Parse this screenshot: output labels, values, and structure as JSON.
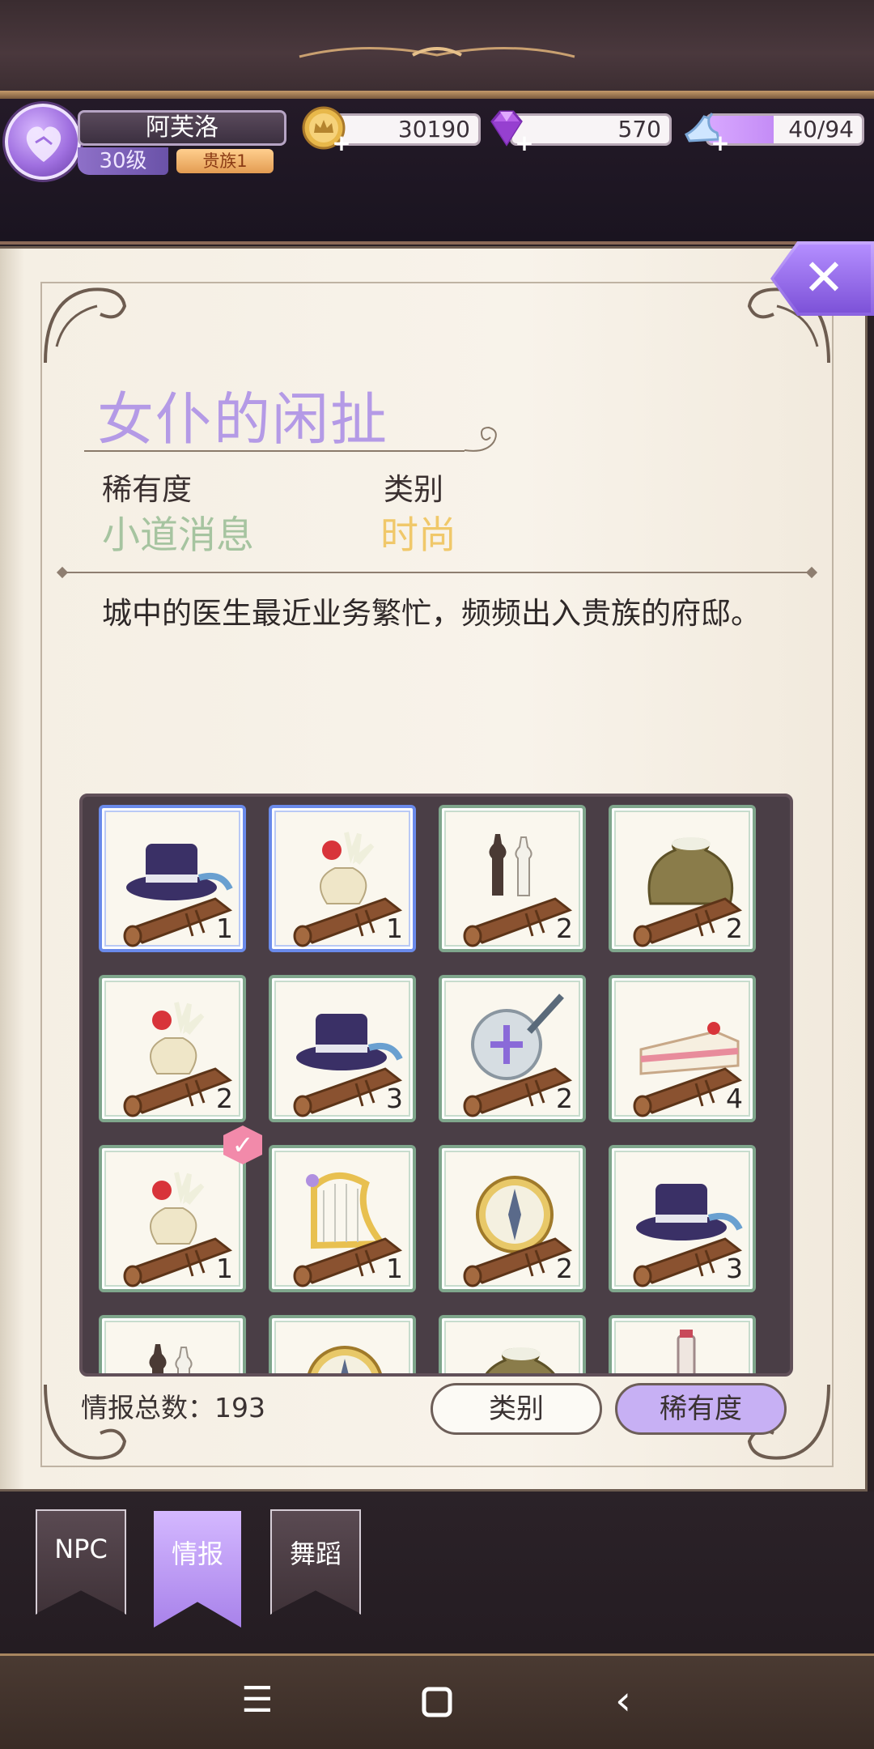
{
  "player": {
    "name": "阿芙洛",
    "level": "30级",
    "noble_rank": "贵族1"
  },
  "resources": {
    "gold": "30190",
    "diamonds": "570",
    "stamina": "40/94",
    "stamina_fraction": 0.4255
  },
  "detail": {
    "title": "女仆的闲扯",
    "rarity_label": "稀有度",
    "rarity_value": "小道消息",
    "type_label": "类别",
    "type_value": "时尚",
    "description": "城中的医生最近业务繁忙，频频出入贵族的府邸。"
  },
  "grid": {
    "items": [
      {
        "icon": "top-hat-scroll-icon",
        "count": "1",
        "selected": true
      },
      {
        "icon": "flower-vase-scroll-icon",
        "count": "1",
        "selected": true
      },
      {
        "icon": "chess-scroll-icon",
        "count": "2",
        "selected": false
      },
      {
        "icon": "sack-scroll-icon",
        "count": "2",
        "selected": false
      },
      {
        "icon": "flower-vase-scroll-icon",
        "count": "2",
        "selected": false
      },
      {
        "icon": "top-hat-scroll-icon",
        "count": "3",
        "selected": false
      },
      {
        "icon": "sword-shield-scroll-icon",
        "count": "2",
        "selected": false
      },
      {
        "icon": "cake-scroll-icon",
        "count": "4",
        "selected": false
      },
      {
        "icon": "flower-vase-scroll-icon",
        "count": "1",
        "selected": false
      },
      {
        "icon": "harp-scroll-icon",
        "count": "1",
        "selected": false
      },
      {
        "icon": "compass-scroll-icon",
        "count": "2",
        "selected": false
      },
      {
        "icon": "top-hat-scroll-icon",
        "count": "3",
        "selected": false
      },
      {
        "icon": "chess-scroll-icon",
        "count": "",
        "selected": false
      },
      {
        "icon": "compass-scroll-icon",
        "count": "",
        "selected": false
      },
      {
        "icon": "sack-scroll-icon",
        "count": "",
        "selected": false
      },
      {
        "icon": "bottle-scroll-icon",
        "count": "",
        "selected": false
      }
    ]
  },
  "footer": {
    "total_label": "情报总数：193",
    "sort_type_label": "类别",
    "sort_rarity_label": "稀有度"
  },
  "tabs": [
    {
      "label": "NPC",
      "active": false
    },
    {
      "label": "情报",
      "active": true
    },
    {
      "label": "舞蹈",
      "active": false
    }
  ],
  "nav": {
    "menu_glyph": "☰",
    "back_glyph": "‹"
  },
  "colors": {
    "accent_purple": "#b49ae6",
    "rarity_green": "#a6c4a0",
    "type_gold": "#f0c86a"
  }
}
